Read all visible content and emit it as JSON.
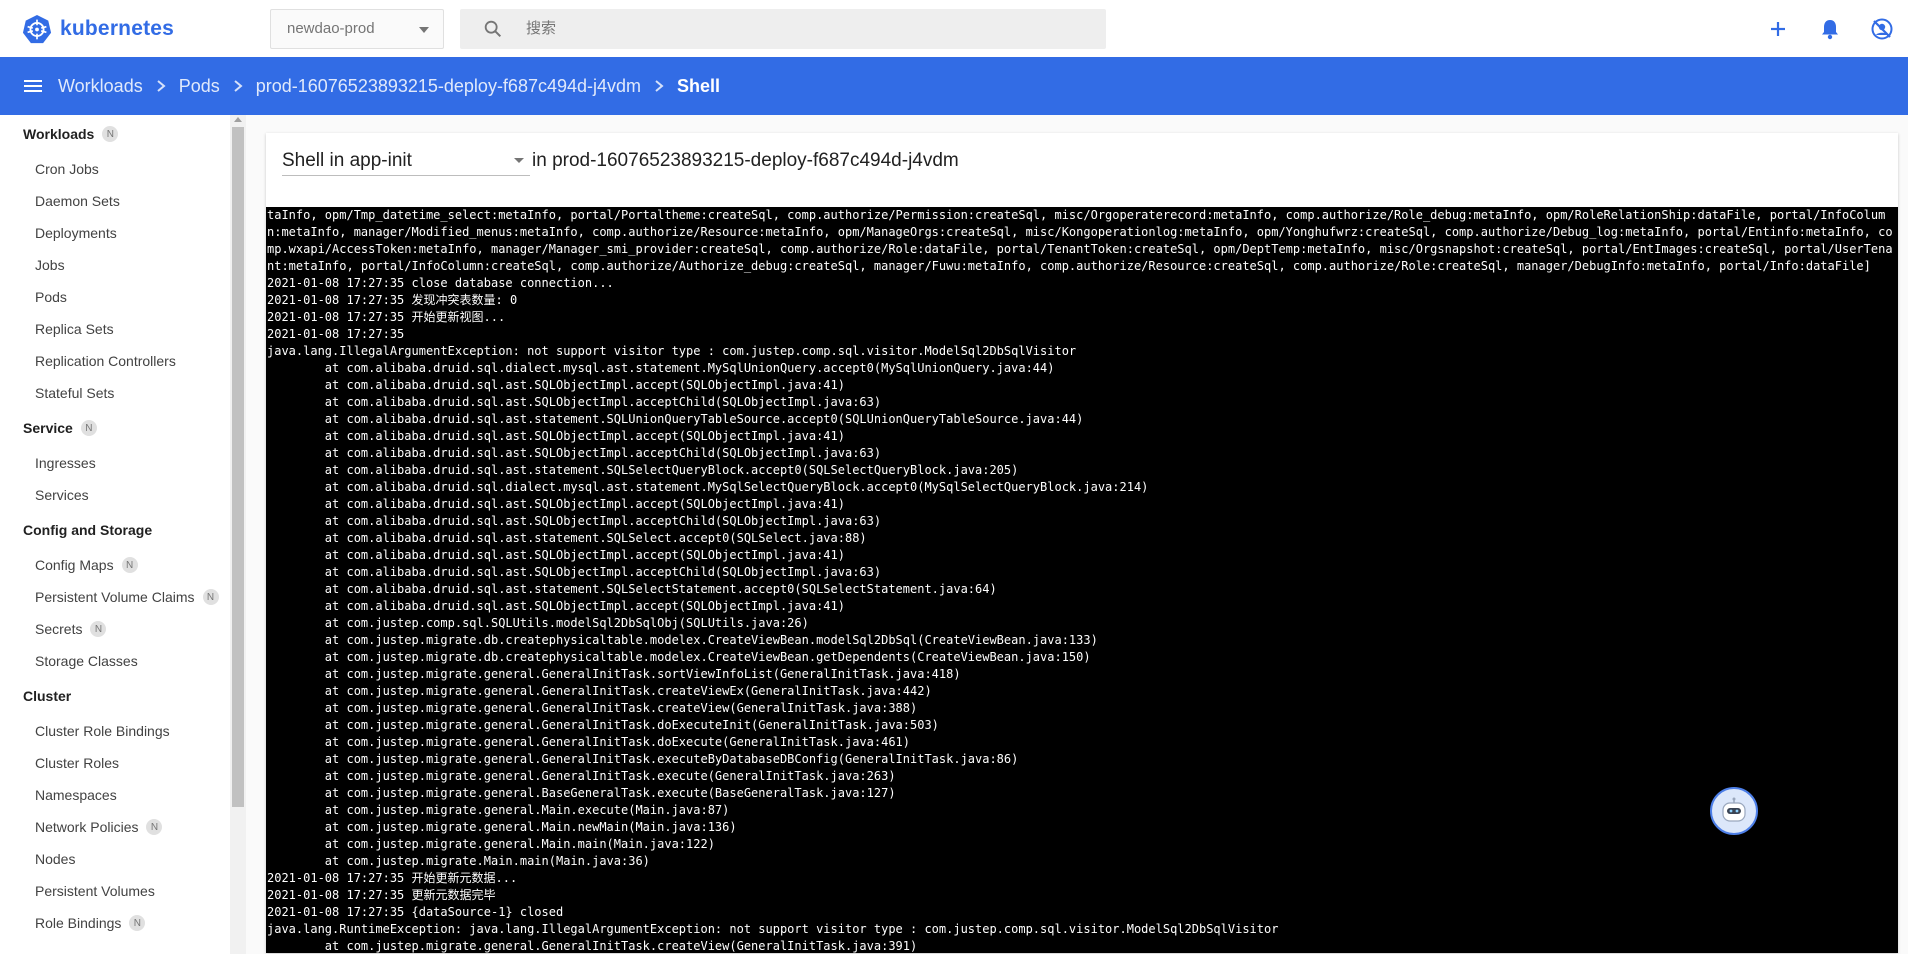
{
  "brand": {
    "name": "kubernetes"
  },
  "namespace": {
    "selected": "newdao-prod"
  },
  "search": {
    "placeholder": "搜索"
  },
  "top_actions": [
    "add-icon",
    "bell-icon",
    "user-disabled-icon"
  ],
  "breadcrumb": {
    "items": [
      "Workloads",
      "Pods",
      "prod-16076523893215-deploy-f687c494d-j4vdm",
      "Shell"
    ]
  },
  "sidebar": {
    "sections": [
      {
        "title": "Workloads",
        "badge": "N",
        "items": [
          {
            "label": "Cron Jobs"
          },
          {
            "label": "Daemon Sets"
          },
          {
            "label": "Deployments"
          },
          {
            "label": "Jobs"
          },
          {
            "label": "Pods"
          },
          {
            "label": "Replica Sets"
          },
          {
            "label": "Replication Controllers"
          },
          {
            "label": "Stateful Sets"
          }
        ]
      },
      {
        "title": "Service",
        "badge": "N",
        "items": [
          {
            "label": "Ingresses"
          },
          {
            "label": "Services"
          }
        ]
      },
      {
        "title": "Config and Storage",
        "badge": "",
        "items": [
          {
            "label": "Config Maps",
            "badge": "N"
          },
          {
            "label": "Persistent Volume Claims",
            "badge": "N"
          },
          {
            "label": "Secrets",
            "badge": "N"
          },
          {
            "label": "Storage Classes"
          }
        ]
      },
      {
        "title": "Cluster",
        "badge": "",
        "items": [
          {
            "label": "Cluster Role Bindings"
          },
          {
            "label": "Cluster Roles"
          },
          {
            "label": "Namespaces"
          },
          {
            "label": "Network Policies",
            "badge": "N"
          },
          {
            "label": "Nodes"
          },
          {
            "label": "Persistent Volumes"
          },
          {
            "label": "Role Bindings",
            "badge": "N"
          }
        ]
      }
    ]
  },
  "shell": {
    "prefix": "Shell in",
    "container": "app-init",
    "in_pod": "in prod-16076523893215-deploy-f687c494d-j4vdm"
  },
  "terminal": {
    "lines": [
      "taInfo, opm/Tmp_datetime_select:metaInfo, portal/Portaltheme:createSql, comp.authorize/Permission:createSql, misc/Orgoperaterecord:metaInfo, comp.authorize/Role_debug:metaInfo, opm/RoleRelationShip:dataFile, portal/InfoColumn:metaInfo, manager/Modified_menus:metaInfo, comp.authorize/Resource:metaInfo, opm/ManageOrgs:createSql, misc/Kongoperationlog:metaInfo, opm/Yonghufwrz:createSql, comp.authorize/Debug_log:metaInfo, portal/Entinfo:metaInfo, comp.wxapi/AccessToken:metaInfo, manager/Manager_smi_provider:createSql, comp.authorize/Role:dataFile, portal/TenantToken:createSql, opm/DeptTemp:metaInfo, misc/Orgsnapshot:createSql, portal/EntImages:createSql, portal/UserTenant:metaInfo, portal/InfoColumn:createSql, comp.authorize/Authorize_debug:createSql, manager/Fuwu:metaInfo, comp.authorize/Resource:createSql, comp.authorize/Role:createSql, manager/DebugInfo:metaInfo, portal/Info:dataFile]",
      "2021-01-08 17:27:35 close database connection...",
      "2021-01-08 17:27:35 发现冲突表数量: 0",
      "2021-01-08 17:27:35 开始更新视图...",
      "2021-01-08 17:27:35",
      "java.lang.IllegalArgumentException: not support visitor type : com.justep.comp.sql.visitor.ModelSql2DbSqlVisitor",
      "        at com.alibaba.druid.sql.dialect.mysql.ast.statement.MySqlUnionQuery.accept0(MySqlUnionQuery.java:44)",
      "        at com.alibaba.druid.sql.ast.SQLObjectImpl.accept(SQLObjectImpl.java:41)",
      "        at com.alibaba.druid.sql.ast.SQLObjectImpl.acceptChild(SQLObjectImpl.java:63)",
      "        at com.alibaba.druid.sql.ast.statement.SQLUnionQueryTableSource.accept0(SQLUnionQueryTableSource.java:44)",
      "        at com.alibaba.druid.sql.ast.SQLObjectImpl.accept(SQLObjectImpl.java:41)",
      "        at com.alibaba.druid.sql.ast.SQLObjectImpl.acceptChild(SQLObjectImpl.java:63)",
      "        at com.alibaba.druid.sql.ast.statement.SQLSelectQueryBlock.accept0(SQLSelectQueryBlock.java:205)",
      "        at com.alibaba.druid.sql.dialect.mysql.ast.statement.MySqlSelectQueryBlock.accept0(MySqlSelectQueryBlock.java:214)",
      "        at com.alibaba.druid.sql.ast.SQLObjectImpl.accept(SQLObjectImpl.java:41)",
      "        at com.alibaba.druid.sql.ast.SQLObjectImpl.acceptChild(SQLObjectImpl.java:63)",
      "        at com.alibaba.druid.sql.ast.statement.SQLSelect.accept0(SQLSelect.java:88)",
      "        at com.alibaba.druid.sql.ast.SQLObjectImpl.accept(SQLObjectImpl.java:41)",
      "        at com.alibaba.druid.sql.ast.SQLObjectImpl.acceptChild(SQLObjectImpl.java:63)",
      "        at com.alibaba.druid.sql.ast.statement.SQLSelectStatement.accept0(SQLSelectStatement.java:64)",
      "        at com.alibaba.druid.sql.ast.SQLObjectImpl.accept(SQLObjectImpl.java:41)",
      "        at com.justep.comp.sql.SQLUtils.modelSql2DbSqlObj(SQLUtils.java:26)",
      "        at com.justep.migrate.db.createphysicaltable.modelex.CreateViewBean.modelSql2DbSql(CreateViewBean.java:133)",
      "        at com.justep.migrate.db.createphysicaltable.modelex.CreateViewBean.getDependents(CreateViewBean.java:150)",
      "        at com.justep.migrate.general.GeneralInitTask.sortViewInfoList(GeneralInitTask.java:418)",
      "        at com.justep.migrate.general.GeneralInitTask.createViewEx(GeneralInitTask.java:442)",
      "        at com.justep.migrate.general.GeneralInitTask.createView(GeneralInitTask.java:388)",
      "        at com.justep.migrate.general.GeneralInitTask.doExecuteInit(GeneralInitTask.java:503)",
      "        at com.justep.migrate.general.GeneralInitTask.doExecute(GeneralInitTask.java:461)",
      "        at com.justep.migrate.general.GeneralInitTask.executeByDatabaseDBConfig(GeneralInitTask.java:86)",
      "        at com.justep.migrate.general.GeneralInitTask.execute(GeneralInitTask.java:263)",
      "        at com.justep.migrate.general.BaseGeneralTask.execute(BaseGeneralTask.java:127)",
      "        at com.justep.migrate.general.Main.execute(Main.java:87)",
      "        at com.justep.migrate.general.Main.newMain(Main.java:136)",
      "        at com.justep.migrate.general.Main.main(Main.java:122)",
      "        at com.justep.migrate.Main.main(Main.java:36)",
      "2021-01-08 17:27:35 开始更新元数据...",
      "2021-01-08 17:27:35 更新元数据完毕",
      "2021-01-08 17:27:35 {dataSource-1} closed",
      "java.lang.RuntimeException: java.lang.IllegalArgumentException: not support visitor type : com.justep.comp.sql.visitor.ModelSql2DbSqlVisitor",
      "        at com.justep.migrate.general.GeneralInitTask.createView(GeneralInitTask.java:391)"
    ]
  },
  "colors": {
    "brand": "#326ce5",
    "terminal_bg": "#000000",
    "terminal_fg": "#ffffff"
  }
}
